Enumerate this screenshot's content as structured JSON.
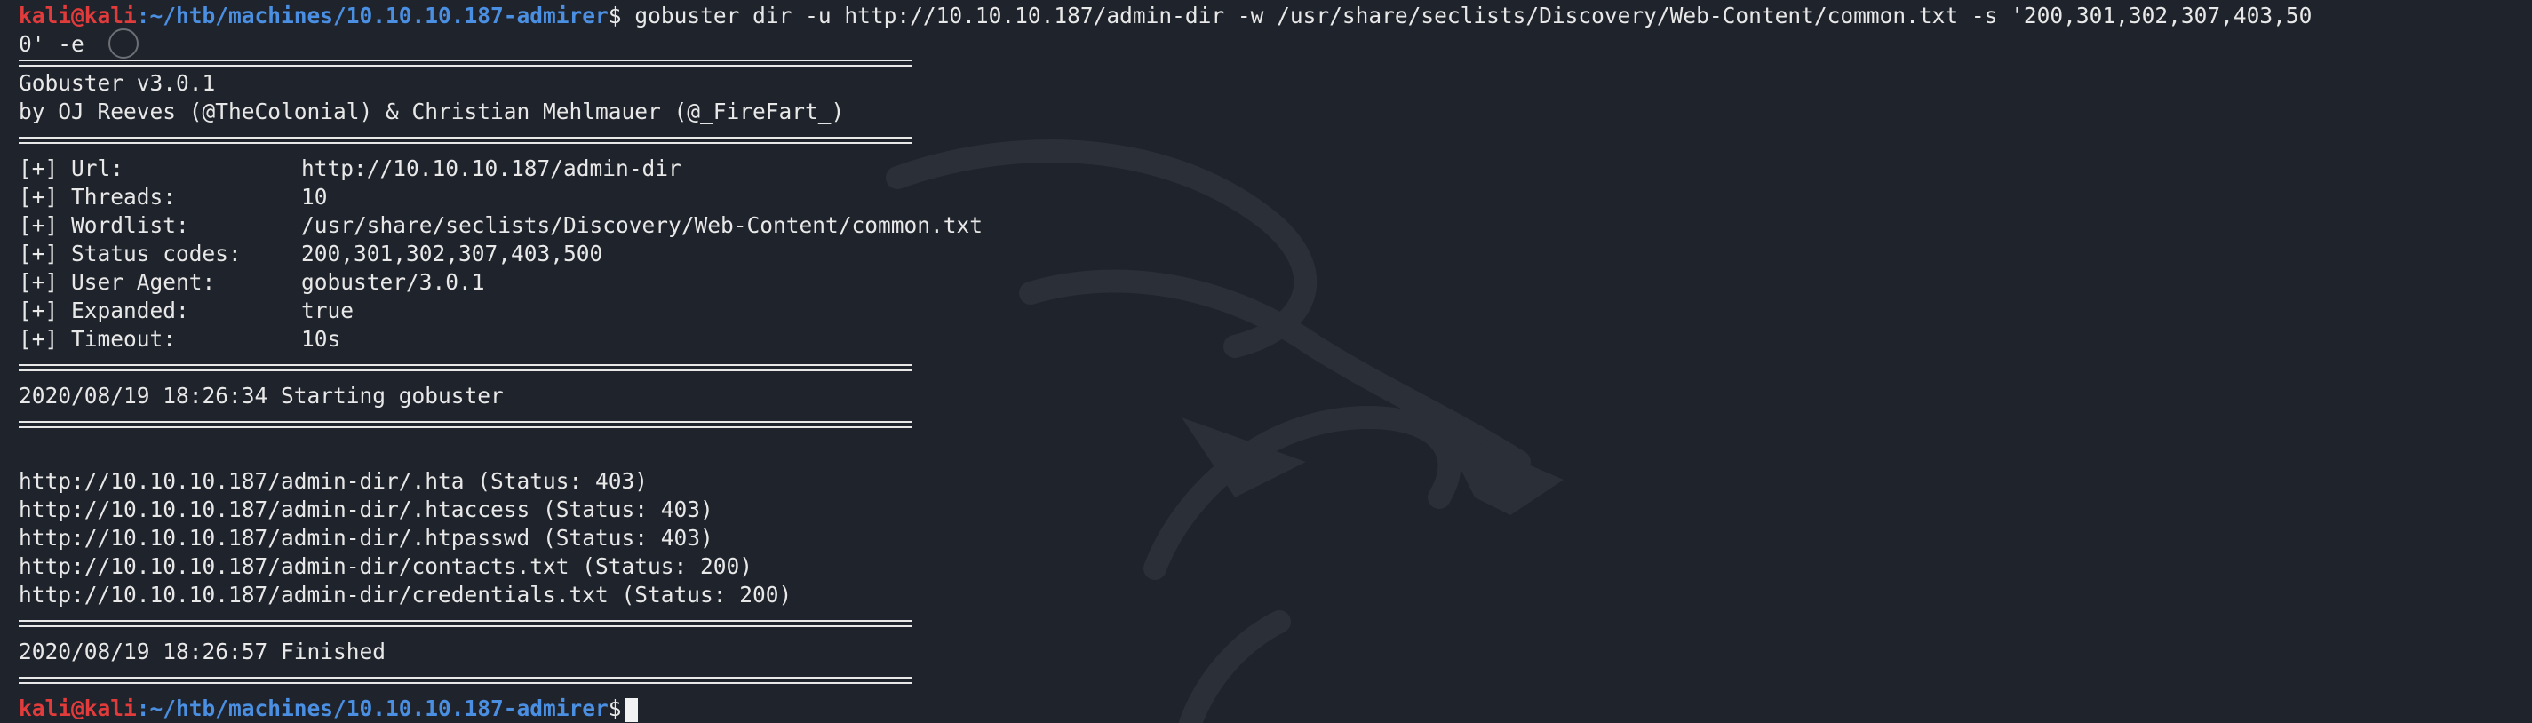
{
  "prompt": {
    "user_host": "kali@kali",
    "colon": ":",
    "path": "~/htb/machines/10.10.10.187-admirer",
    "symbol": "$"
  },
  "command": {
    "text_line1": " gobuster dir -u http://10.10.10.187/admin-dir -w /usr/share/seclists/Discovery/Web-Content/common.txt -s '200,301,302,307,403,50",
    "text_line2": "0' -e"
  },
  "banner": {
    "version": "Gobuster v3.0.1",
    "authors": "by OJ Reeves (@TheColonial) & Christian Mehlmauer (@_FireFart_)"
  },
  "config": [
    {
      "label": "[+] Url:",
      "value": "http://10.10.10.187/admin-dir"
    },
    {
      "label": "[+] Threads:",
      "value": "10"
    },
    {
      "label": "[+] Wordlist:",
      "value": "/usr/share/seclists/Discovery/Web-Content/common.txt"
    },
    {
      "label": "[+] Status codes:",
      "value": "200,301,302,307,403,500"
    },
    {
      "label": "[+] User Agent:",
      "value": "gobuster/3.0.1"
    },
    {
      "label": "[+] Expanded:",
      "value": "true"
    },
    {
      "label": "[+] Timeout:",
      "value": "10s"
    }
  ],
  "start_message": "2020/08/19 18:26:34 Starting gobuster",
  "results": [
    "http://10.10.10.187/admin-dir/.hta (Status: 403)",
    "http://10.10.10.187/admin-dir/.htaccess (Status: 403)",
    "http://10.10.10.187/admin-dir/.htpasswd (Status: 403)",
    "http://10.10.10.187/admin-dir/contacts.txt (Status: 200)",
    "http://10.10.10.187/admin-dir/credentials.txt (Status: 200)"
  ],
  "finish_message": "2020/08/19 18:26:57 Finished",
  "colors": {
    "background": "#1f232b",
    "prompt_user": "#e23b3b",
    "prompt_path": "#4a8fe2",
    "text": "#e8e8e8"
  },
  "icons": {
    "background_logo": "kali-dragon-icon",
    "cursor": "block-cursor"
  }
}
